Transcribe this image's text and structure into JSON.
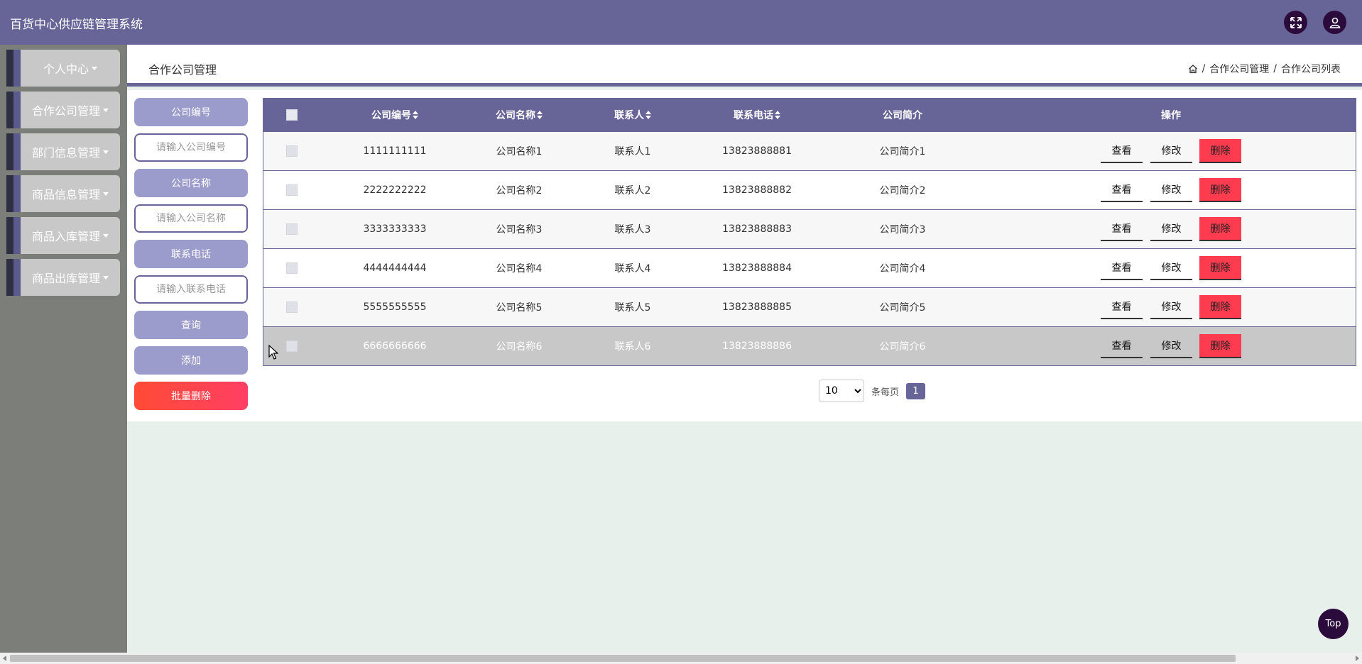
{
  "app": {
    "title": "百货中心供应链管理系统"
  },
  "colors": {
    "primary": "#676597",
    "dark": "#2b0b3b",
    "danger": "#ff3b4f",
    "sidebar": "#7c7e7a"
  },
  "header": {
    "fullscreen_icon": "expand-icon",
    "user_icon": "user-icon"
  },
  "sidebar": {
    "items": [
      {
        "label": "个人中心"
      },
      {
        "label": "合作公司管理"
      },
      {
        "label": "部门信息管理"
      },
      {
        "label": "商品信息管理"
      },
      {
        "label": "商品入库管理"
      },
      {
        "label": "商品出库管理"
      }
    ]
  },
  "page": {
    "title": "合作公司管理",
    "breadcrumb": {
      "level1": "合作公司管理",
      "level2": "合作公司列表",
      "sep": "/"
    }
  },
  "search": {
    "company_no_label": "公司编号",
    "company_no_placeholder": "请输入公司编号",
    "company_name_label": "公司名称",
    "company_name_placeholder": "请输入公司名称",
    "phone_label": "联系电话",
    "phone_placeholder": "请输入联系电话",
    "query_label": "查询",
    "add_label": "添加",
    "batch_delete_label": "批量删除"
  },
  "table": {
    "headers": {
      "no": "公司编号",
      "name": "公司名称",
      "contact": "联系人",
      "phone": "联系电话",
      "intro": "公司简介",
      "ops": "操作"
    },
    "actions": {
      "view": "查看",
      "edit": "修改",
      "del": "删除"
    },
    "rows": [
      {
        "no": "1111111111",
        "name": "公司名称1",
        "contact": "联系人1",
        "phone": "13823888881",
        "intro": "公司简介1"
      },
      {
        "no": "2222222222",
        "name": "公司名称2",
        "contact": "联系人2",
        "phone": "13823888882",
        "intro": "公司简介2"
      },
      {
        "no": "3333333333",
        "name": "公司名称3",
        "contact": "联系人3",
        "phone": "13823888883",
        "intro": "公司简介3"
      },
      {
        "no": "4444444444",
        "name": "公司名称4",
        "contact": "联系人4",
        "phone": "13823888884",
        "intro": "公司简介4"
      },
      {
        "no": "5555555555",
        "name": "公司名称5",
        "contact": "联系人5",
        "phone": "13823888885",
        "intro": "公司简介5"
      },
      {
        "no": "6666666666",
        "name": "公司名称6",
        "contact": "联系人6",
        "phone": "13823888886",
        "intro": "公司简介6"
      }
    ]
  },
  "pagination": {
    "page_size": "10",
    "per_page_label": "条每页",
    "current_page": "1"
  },
  "top_button": {
    "label": "Top"
  }
}
